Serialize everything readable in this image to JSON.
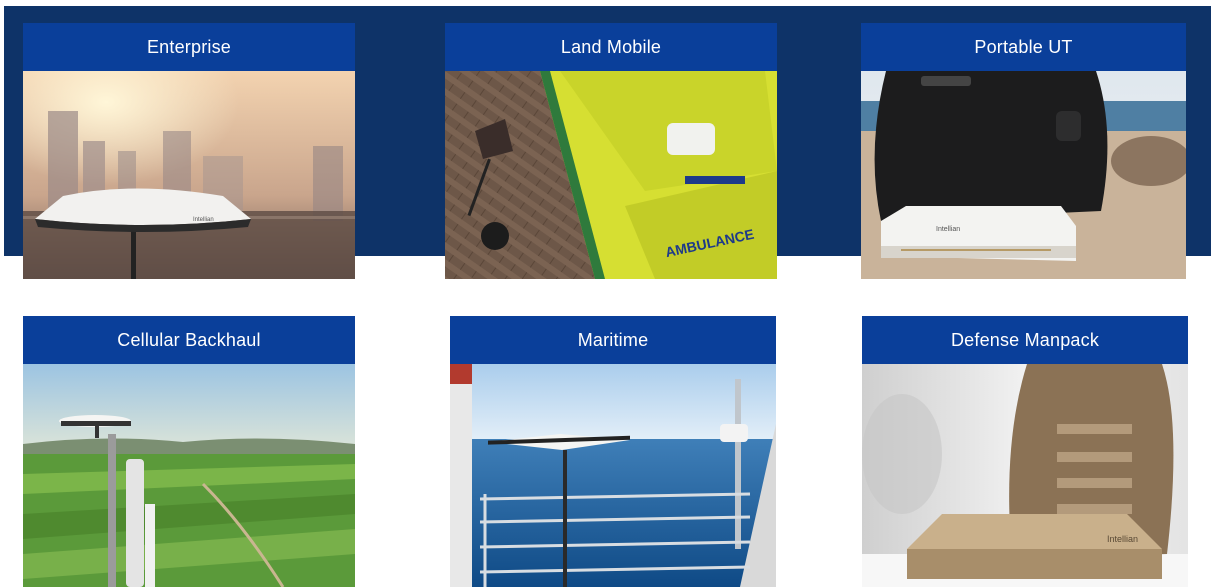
{
  "cards": [
    {
      "title": "Enterprise"
    },
    {
      "title": "Land Mobile",
      "image_text": "AMBULANCE"
    },
    {
      "title": "Portable UT",
      "image_text": "Intellian"
    },
    {
      "title": "Cellular Backhaul"
    },
    {
      "title": "Maritime"
    },
    {
      "title": "Defense Manpack",
      "image_text": "Intellian"
    }
  ],
  "colors": {
    "band": "#0e3368",
    "header": "#0a3f9a",
    "header_text": "#ffffff"
  }
}
